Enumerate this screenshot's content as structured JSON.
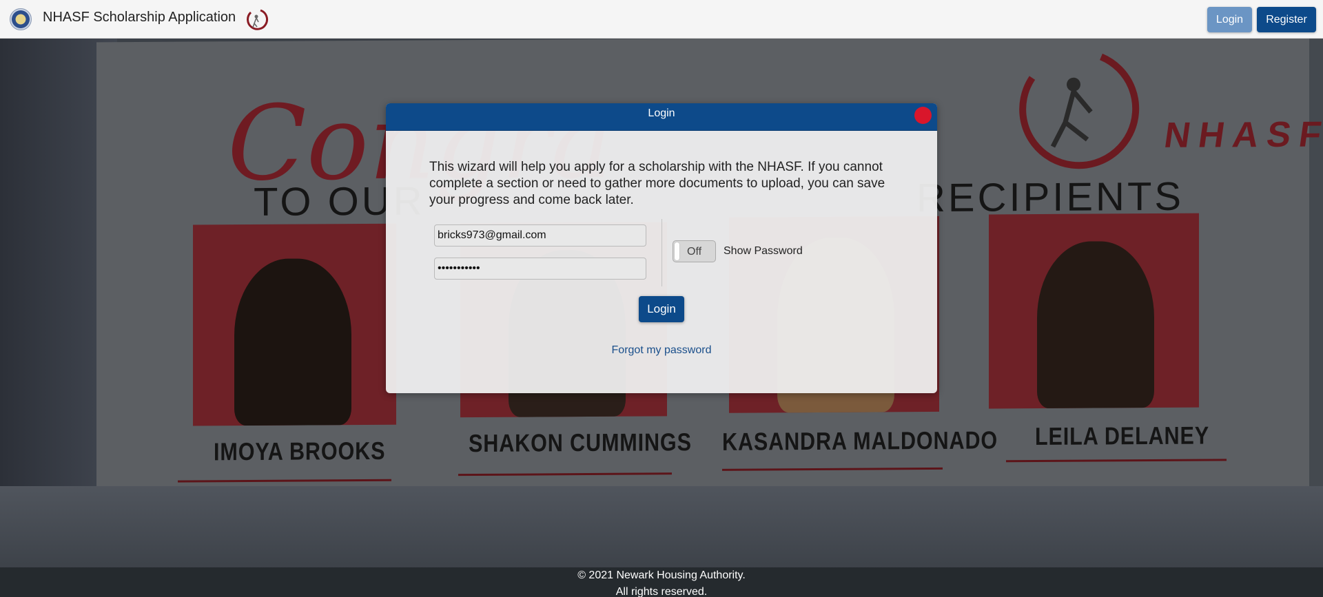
{
  "header": {
    "title": "NHASF Scholarship Application",
    "login_label": "Login",
    "register_label": "Register"
  },
  "modal": {
    "title": "Login",
    "intro": "This wizard will help you apply for a scholarship with the NHASF. If you cannot complete a section or need to gather more documents to upload, you can save your progress and come back later.",
    "email_value": "bricks973@gmail.com",
    "password_value": "•••••••••••",
    "toggle_state": "Off",
    "show_password_label": "Show Password",
    "submit_label": "Login",
    "forgot_link": "Forgot my password"
  },
  "background_banner": {
    "script_text": "Congrats!",
    "heading_left": "TO OUR",
    "heading_right": "RECIPIENTS",
    "logo_text": "NHASF",
    "recipients": [
      "IMOYA BROOKS",
      "SHAKON CUMMINGS",
      "KASANDRA MALDONADO",
      "LEILA DELANEY"
    ]
  },
  "footer": {
    "line1": "© 2021 Newark Housing Authority.",
    "line2": "All rights reserved."
  },
  "colors": {
    "primary": "#0d4a8a",
    "primary_light": "#6b95c4",
    "close": "#d9162b",
    "link": "#1a4f8b",
    "footer_bg": "#252a2e"
  },
  "icons": [
    "seal-icon",
    "nhasf-logo-icon",
    "close-icon"
  ]
}
